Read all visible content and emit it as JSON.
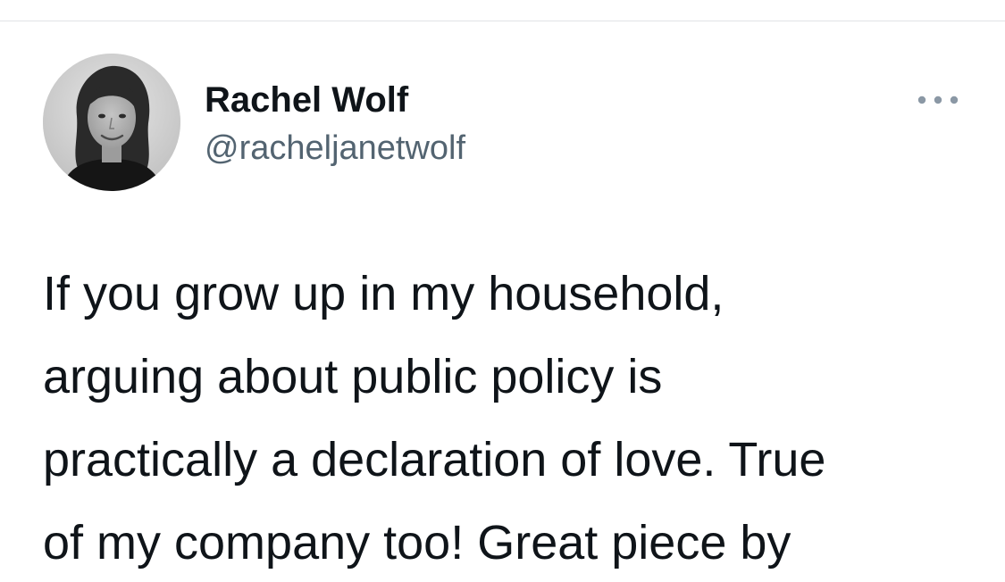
{
  "tweet": {
    "author": {
      "display_name": "Rachel Wolf",
      "handle": "@racheljanetwolf",
      "avatar_icon": "profile-photo"
    },
    "more_icon": "more-horizontal-icon",
    "text_lines": [
      "If you grow up in my household,",
      "arguing about public policy is",
      "practically a declaration of love. True",
      "of my company too! Great piece by"
    ]
  },
  "colors": {
    "text_primary": "#0f1419",
    "text_secondary": "#536471",
    "divider": "#e1e3e6",
    "background": "#ffffff"
  }
}
